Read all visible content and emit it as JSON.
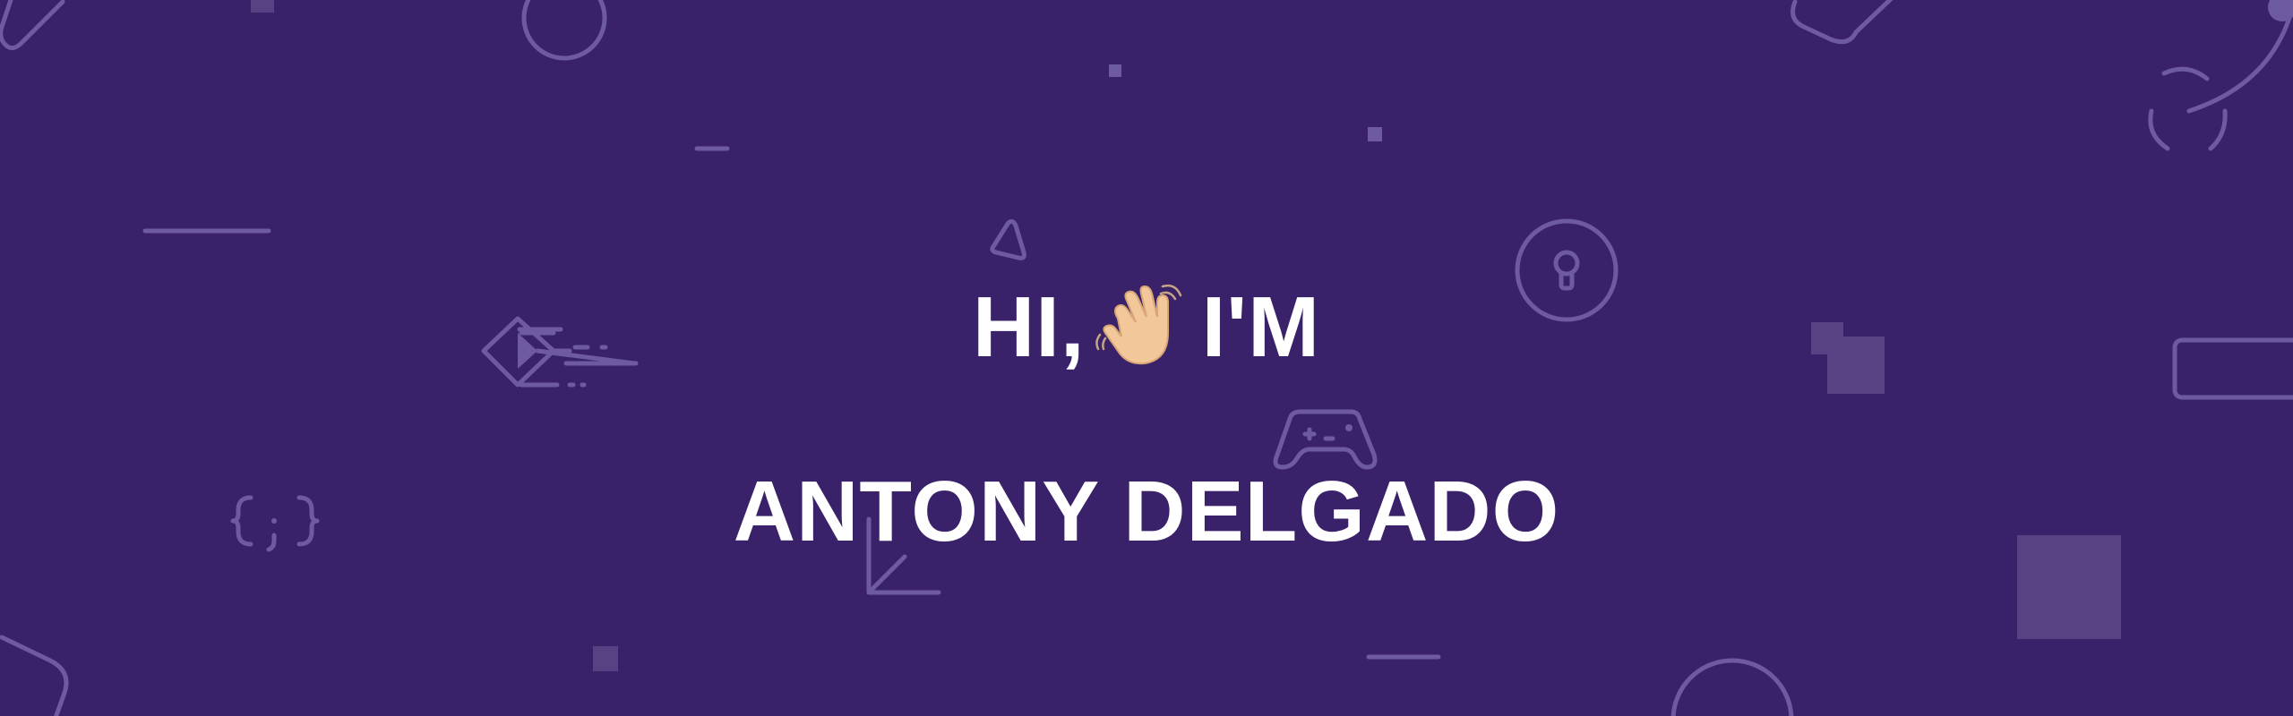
{
  "hero": {
    "greeting_before": "HI,",
    "greeting_after": "I'M",
    "name": "ANTONY DELGADO"
  },
  "colors": {
    "background": "#3a226a",
    "decor": "#6e5aa0",
    "decor_fill": "#574284",
    "text": "#ffffff",
    "emoji_skin": "#f2c79a",
    "emoji_shade": "#d9a676"
  },
  "icons": [
    "waving-hand-icon",
    "code-braces-icon",
    "gamepad-icon",
    "keyhole-icon",
    "diamond-speed-icon",
    "triangle-icon",
    "circle-icon",
    "square-icon",
    "line-icon",
    "arrow-icon"
  ]
}
